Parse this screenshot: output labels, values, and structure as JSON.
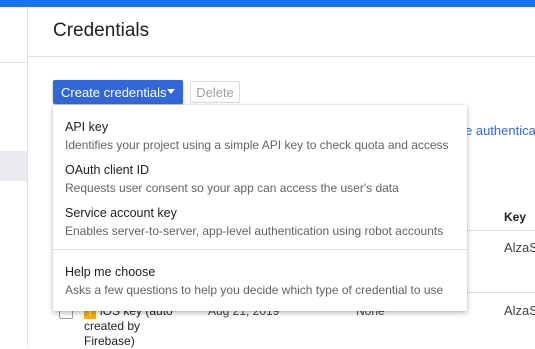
{
  "header": {
    "title": "Credentials"
  },
  "toolbar": {
    "create_label": "Create credentials",
    "delete_label": "Delete"
  },
  "background": {
    "link_text": "e authenticati",
    "table": {
      "key_header": "Key",
      "row1_key": "AlzaS",
      "row2": {
        "name": "iOS key (auto created by Firebase)",
        "date": "Aug 21, 2019",
        "restrictions": "None",
        "key": "AlzaS"
      }
    }
  },
  "menu": {
    "items": [
      {
        "title": "API key",
        "desc": "Identifies your project using a simple API key to check quota and access"
      },
      {
        "title": "OAuth client ID",
        "desc": "Requests user consent so your app can access the user's data"
      },
      {
        "title": "Service account key",
        "desc": "Enables server-to-server, app-level authentication using robot accounts"
      },
      {
        "title": "Help me choose",
        "desc": "Asks a few questions to help you decide which type of credential to use"
      }
    ]
  },
  "colors": {
    "accent": "#3367d6",
    "topbar": "#1a73e8",
    "warning": "#f9ab00"
  }
}
